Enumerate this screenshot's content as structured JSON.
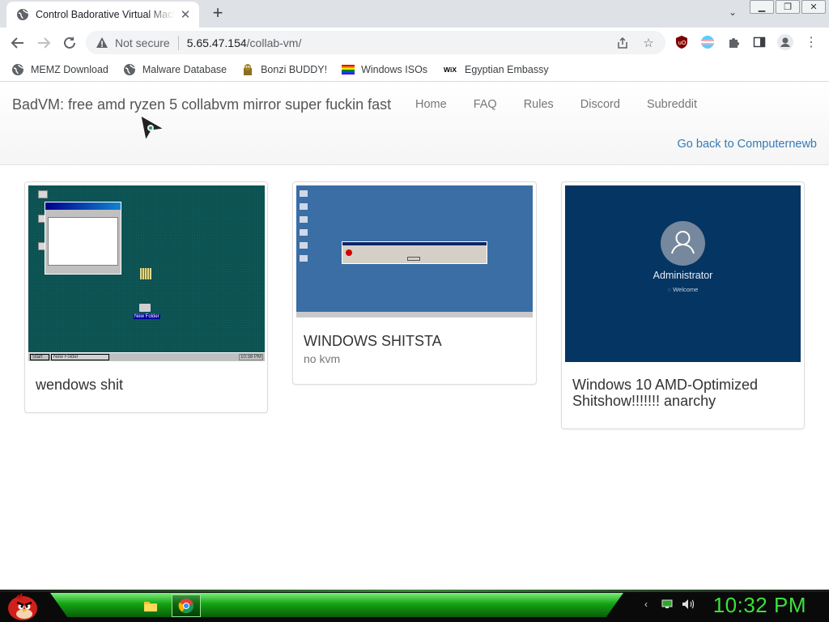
{
  "browser": {
    "tab_title": "Control Badorative Virtual Machi",
    "new_tab_symbol": "+",
    "security_text": "Not secure",
    "url_host": "5.65.47.154",
    "url_path": "/collab-vm/",
    "bookmarks": [
      {
        "label": "MEMZ Download",
        "icon": "globe-icon"
      },
      {
        "label": "Malware Database",
        "icon": "globe-icon"
      },
      {
        "label": "Bonzi BUDDY!",
        "icon": "bonzi-icon"
      },
      {
        "label": "Windows ISOs",
        "icon": "windows-flag-icon"
      },
      {
        "label": "Egyptian Embassy",
        "icon": "wix-icon"
      }
    ],
    "wix_text": "WiX"
  },
  "site": {
    "brand": "BadVM: free amd ryzen 5 collabvm mirror super fuckin fast",
    "nav": [
      "Home",
      "FAQ",
      "Rules",
      "Discord",
      "Subreddit"
    ],
    "back_link": "Go back to Computernewb"
  },
  "vms": [
    {
      "title": "wendows shit",
      "subtitle": ""
    },
    {
      "title": "WINDOWS SHITSTA",
      "subtitle": "no kvm"
    },
    {
      "title": "Windows 10 AMD-Optimized Shitshow!!!!!!! anarchy",
      "subtitle": ""
    }
  ],
  "thumbs": {
    "w98_start": "Start",
    "w98_task": "New Folder",
    "w98_clock": "10:38 PM",
    "w98_folder": "New Folder",
    "w10_user": "Administrator",
    "w10_status": "Welcome"
  },
  "os": {
    "clock": "10:32 PM"
  },
  "colors": {
    "link": "#337ab7",
    "clock_green": "#3ce03c",
    "taskbar_green": "#13a313"
  }
}
